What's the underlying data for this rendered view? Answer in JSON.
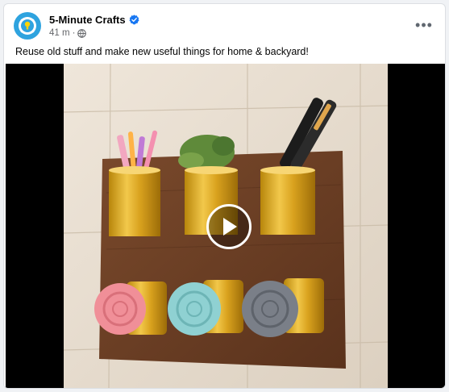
{
  "post": {
    "author": "5-Minute Crafts",
    "timestamp": "41 m",
    "separator": "·",
    "caption": "Reuse old stuff and make new useful things for home & backyard!",
    "more_label": "•••"
  },
  "icons": {
    "avatar": "5-minute-crafts-logo",
    "verified": "verified-badge-icon",
    "audience": "globe-icon",
    "more": "more-options-icon",
    "play": "play-icon"
  },
  "colors": {
    "verified": "#1877f2",
    "avatar_bg": "#2ea3df",
    "meta_text": "#65676b"
  }
}
